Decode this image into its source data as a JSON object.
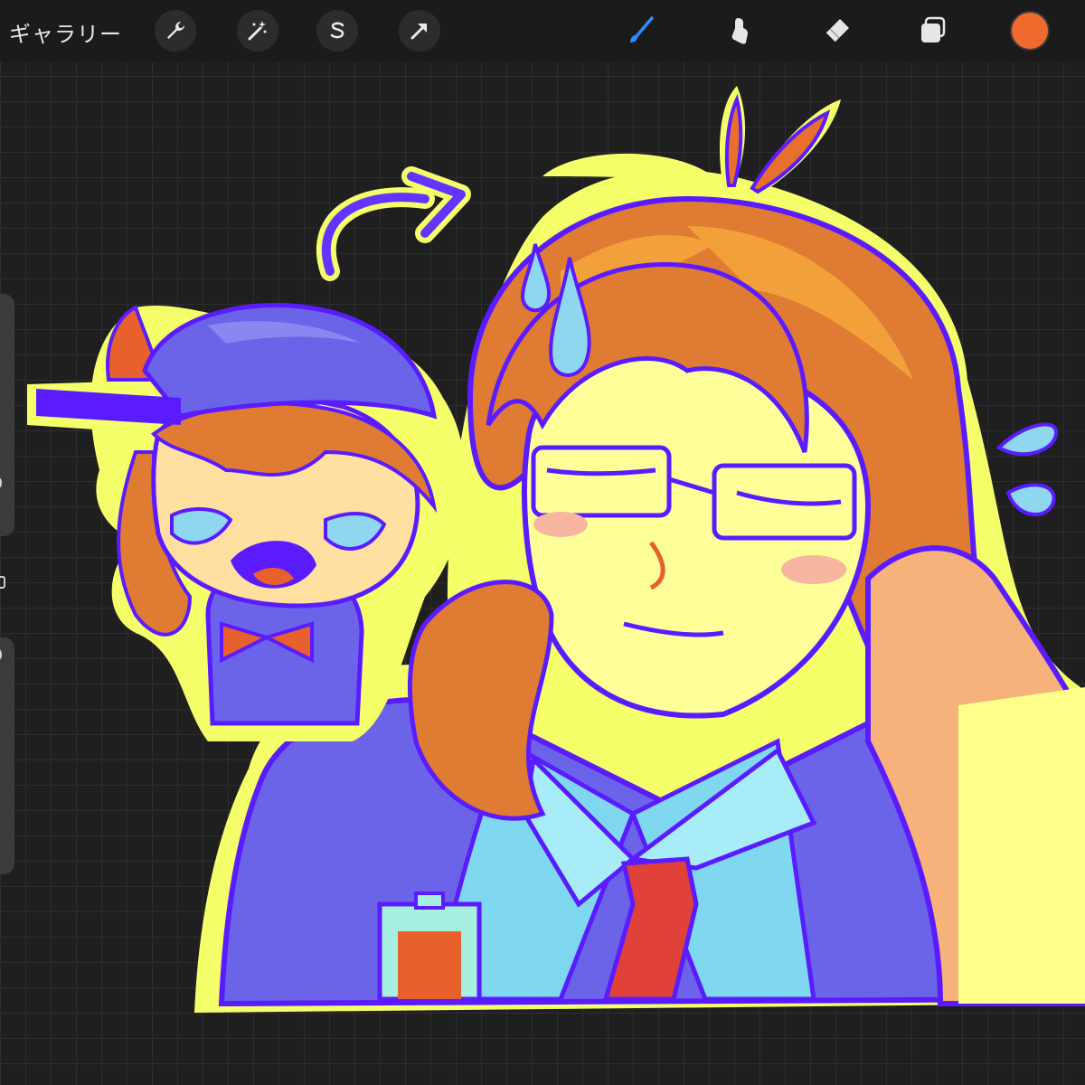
{
  "toolbar": {
    "gallery_label": "ギャラリー",
    "left_tools": [
      {
        "icon": "wrench-icon",
        "label": "actions"
      },
      {
        "icon": "magic-wand-icon",
        "label": "adjustments"
      },
      {
        "icon": "selection-s-icon",
        "label": "selection"
      },
      {
        "icon": "arrow-cursor-icon",
        "label": "transform"
      }
    ],
    "right_tools": [
      {
        "icon": "brush-icon",
        "active": true
      },
      {
        "icon": "smudge-icon",
        "active": false
      },
      {
        "icon": "eraser-icon",
        "active": false
      },
      {
        "icon": "layers-icon",
        "active": false
      }
    ],
    "current_color": "#f06a2e",
    "active_color": "#2f8cff"
  },
  "sidebar": {
    "brush_size_label": "brush size",
    "opacity_label": "opacity"
  },
  "canvas": {
    "outline_color": "#f4ff6a",
    "line_color": "#5a1cff",
    "background": "#1f1f1f"
  }
}
